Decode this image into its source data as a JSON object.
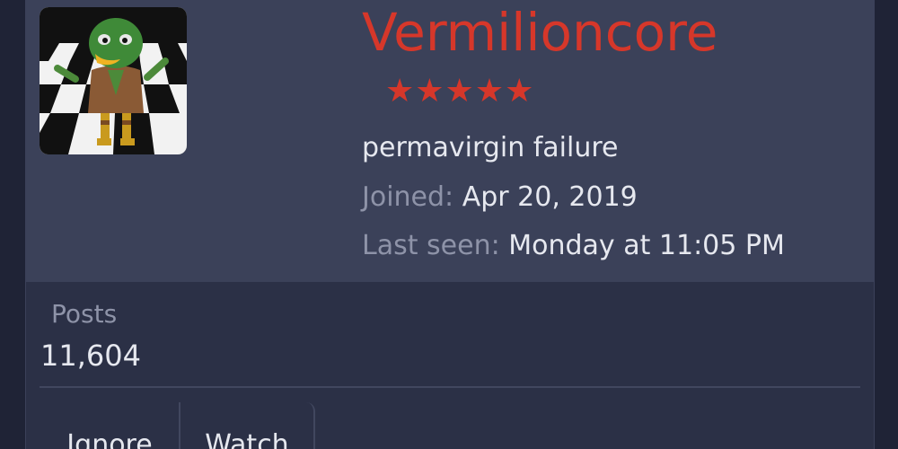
{
  "profile": {
    "username": "Vermilioncore",
    "stars": "★★★★★",
    "rating_stars": 5,
    "user_title": "permavirgin failure",
    "joined_label": "Joined:",
    "joined_value": "Apr 20, 2019",
    "last_seen_label": "Last seen:",
    "last_seen_value": "Monday at 11:05 PM",
    "avatar_icon": "avatar-duck-character"
  },
  "stats": {
    "posts_label": "Posts",
    "posts_value": "11,604"
  },
  "actions": {
    "ignore_label": "Ignore",
    "watch_label": "Watch"
  },
  "colors": {
    "background": "#1f2336",
    "card": "#2b3046",
    "header": "#3b4159",
    "username": "#d6372a",
    "text": "#e6e8ef",
    "muted": "#8e93a8"
  }
}
